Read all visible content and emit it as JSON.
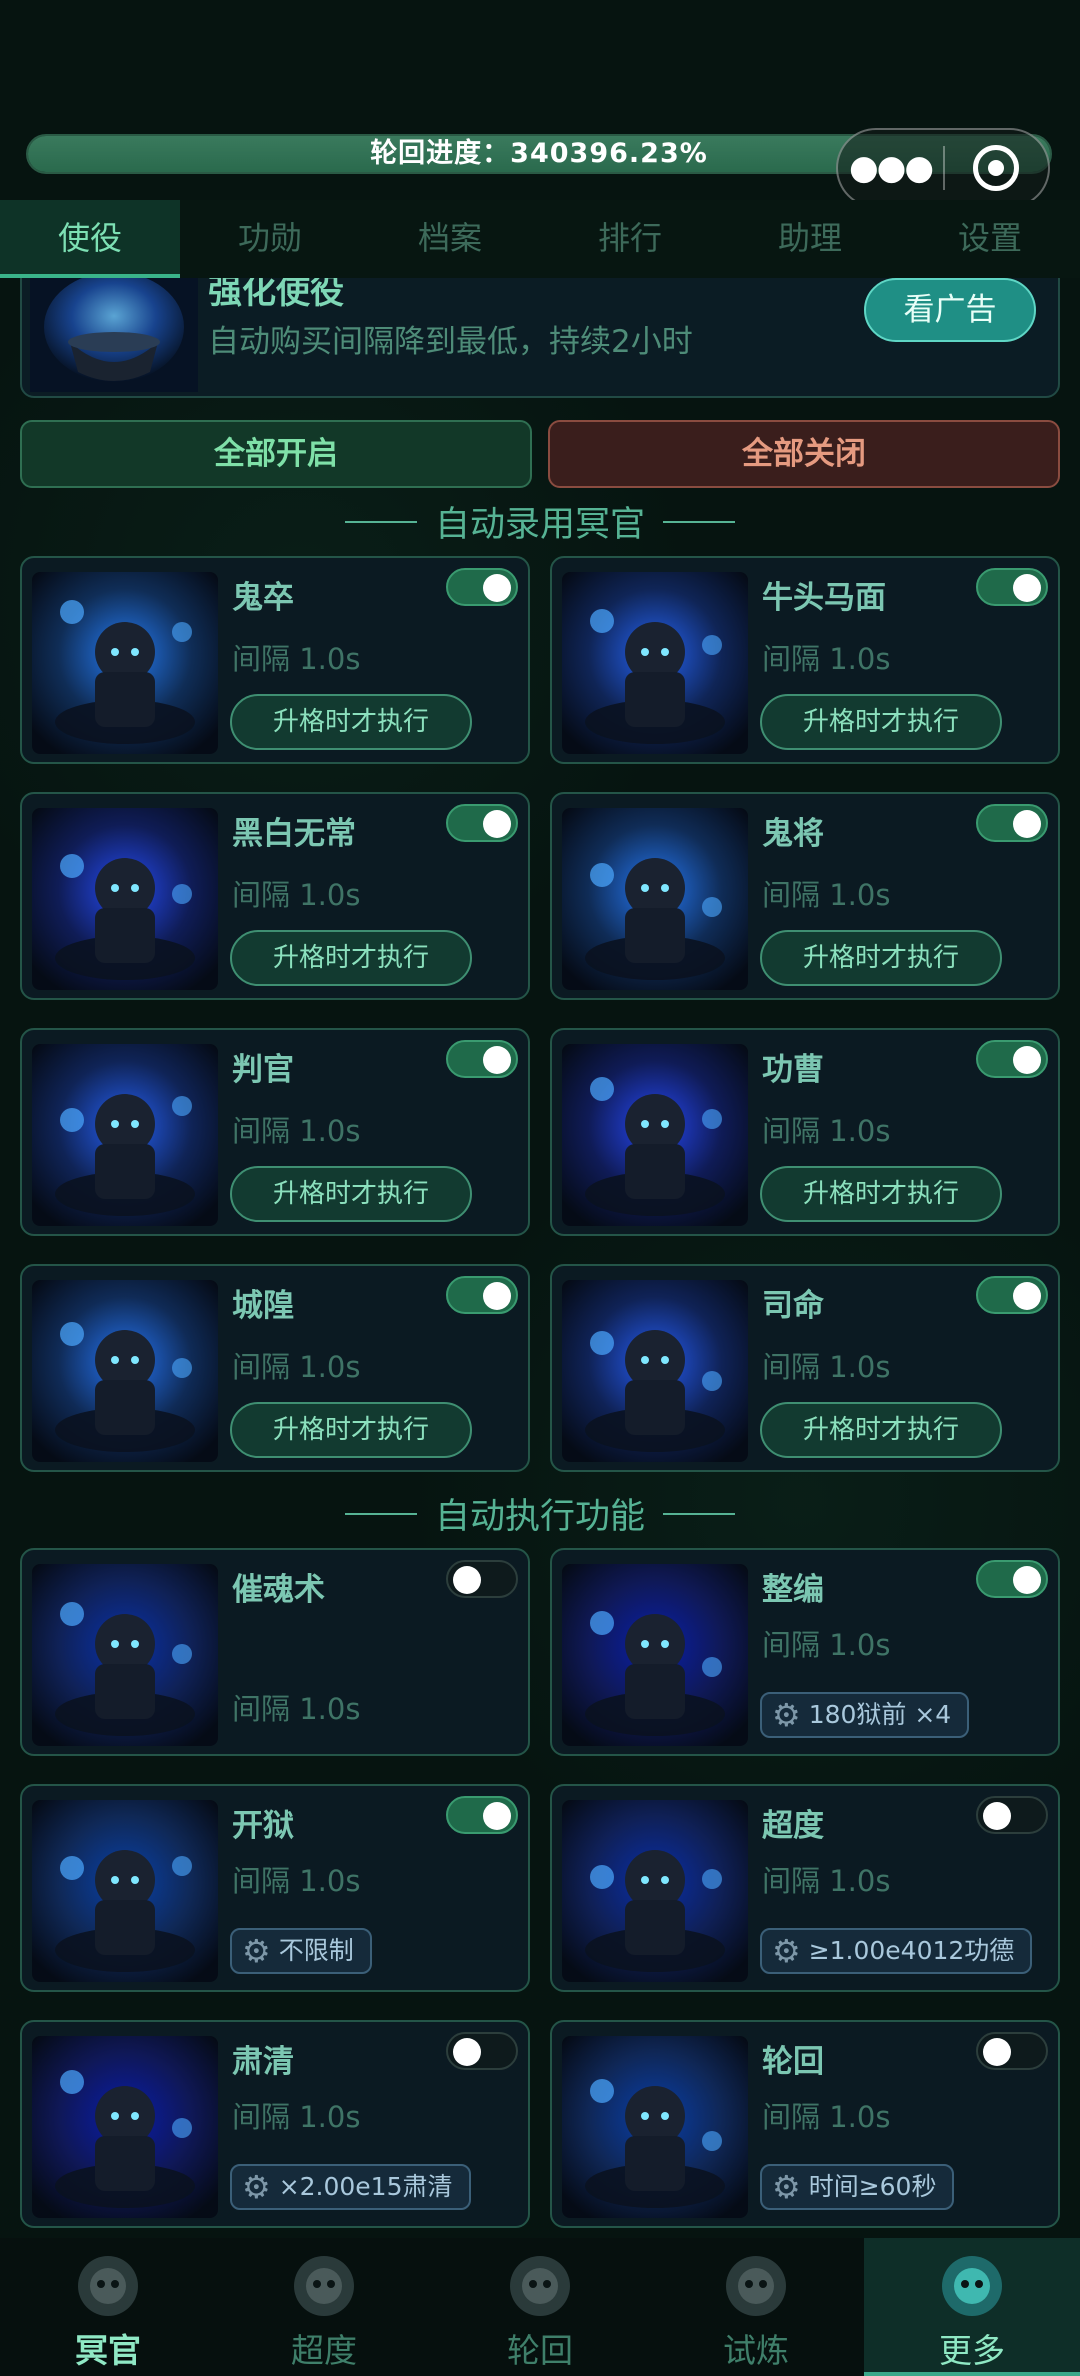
{
  "progress": {
    "label": "轮回进度：340396.23%",
    "fraction": 1.0
  },
  "capsule": {
    "more_icon": "more-dots-icon",
    "close_icon": "target-icon"
  },
  "tabs": [
    {
      "label": "使役",
      "active": true
    },
    {
      "label": "功勋",
      "active": false
    },
    {
      "label": "档案",
      "active": false
    },
    {
      "label": "排行",
      "active": false
    },
    {
      "label": "助理",
      "active": false
    },
    {
      "label": "设置",
      "active": false
    }
  ],
  "banner": {
    "title": "强化使役",
    "desc": "自动购买间隔降到最低，持续2小时",
    "button": "看广告"
  },
  "buttons": {
    "all_on": "全部开启",
    "all_off": "全部关闭"
  },
  "sections": {
    "recruit": "自动录用冥官",
    "execute": "自动执行功能"
  },
  "recruit_cards": [
    {
      "name": "鬼卒",
      "interval": "间隔 1.0s",
      "exec": "升格时才执行",
      "on": true
    },
    {
      "name": "牛头马面",
      "interval": "间隔 1.0s",
      "exec": "升格时才执行",
      "on": true
    },
    {
      "name": "黑白无常",
      "interval": "间隔 1.0s",
      "exec": "升格时才执行",
      "on": true
    },
    {
      "name": "鬼将",
      "interval": "间隔 1.0s",
      "exec": "升格时才执行",
      "on": true
    },
    {
      "name": "判官",
      "interval": "间隔 1.0s",
      "exec": "升格时才执行",
      "on": true
    },
    {
      "name": "功曹",
      "interval": "间隔 1.0s",
      "exec": "升格时才执行",
      "on": true
    },
    {
      "name": "城隍",
      "interval": "间隔 1.0s",
      "exec": "升格时才执行",
      "on": true
    },
    {
      "name": "司命",
      "interval": "间隔 1.0s",
      "exec": "升格时才执行",
      "on": true
    }
  ],
  "execute_cards": [
    {
      "name": "催魂术",
      "interval": "间隔 1.0s",
      "cond": "",
      "on": false
    },
    {
      "name": "整编",
      "interval": "间隔 1.0s",
      "cond": "180狱前 ×4",
      "on": true
    },
    {
      "name": "开狱",
      "interval": "间隔 1.0s",
      "cond": "不限制",
      "on": true
    },
    {
      "name": "超度",
      "interval": "间隔 1.0s",
      "cond": "≥1.00e4012功德",
      "on": false
    },
    {
      "name": "肃清",
      "interval": "间隔 1.0s",
      "cond": "×2.00e15肃清",
      "on": false
    },
    {
      "name": "轮回",
      "interval": "间隔 1.0s",
      "cond": "时间≥60秒",
      "on": false
    }
  ],
  "nav": [
    {
      "label": "冥官",
      "icon": "mask-icon"
    },
    {
      "label": "超度",
      "icon": "skull-icon"
    },
    {
      "label": "轮回",
      "icon": "swirl-icon"
    },
    {
      "label": "试炼",
      "icon": "flame-icon"
    },
    {
      "label": "更多",
      "icon": "flame-emblem-icon",
      "active": true
    }
  ]
}
